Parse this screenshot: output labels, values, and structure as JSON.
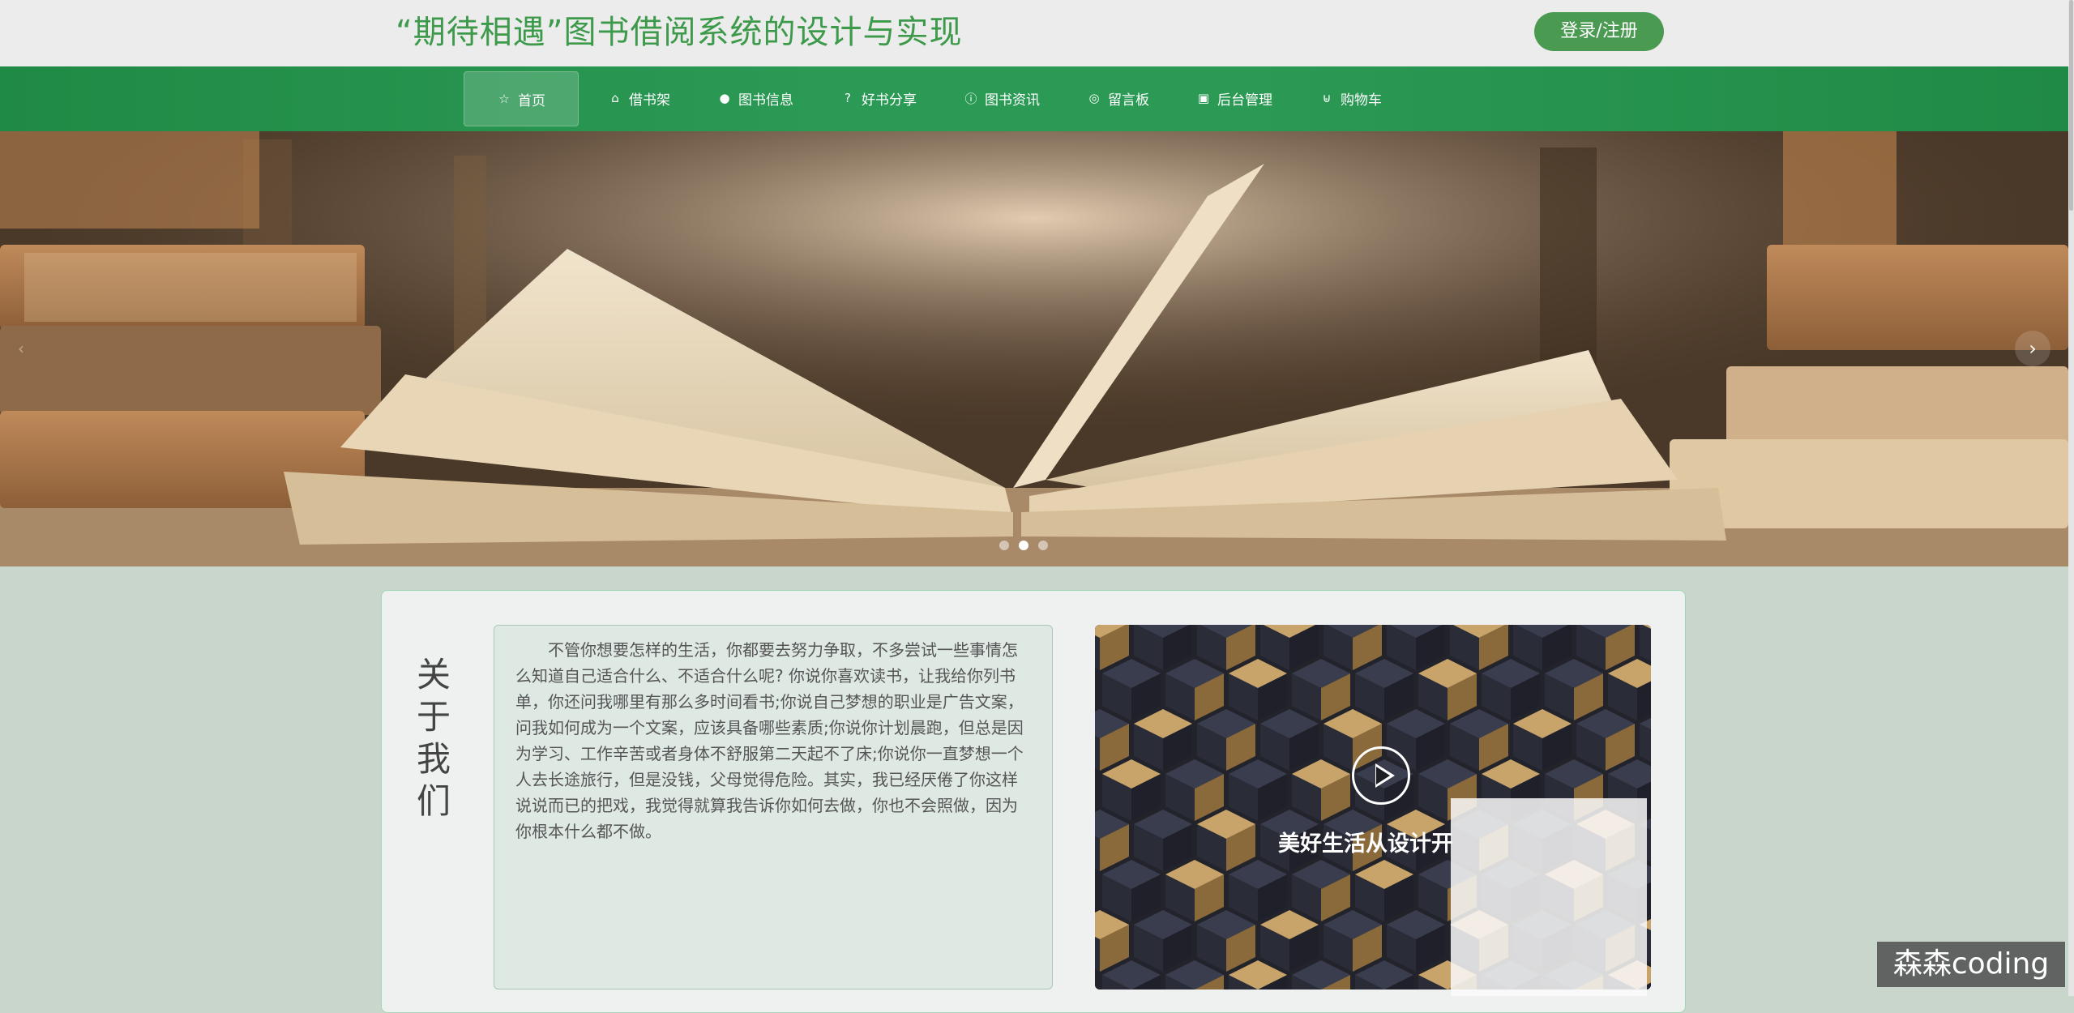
{
  "header": {
    "site_title": "“期待相遇”图书借阅系统的设计与实现",
    "login_label": "登录/注册"
  },
  "nav": {
    "items": [
      {
        "label": "首页",
        "icon": "star-icon",
        "glyph": "☆"
      },
      {
        "label": "借书架",
        "icon": "shelf-icon",
        "glyph": "⌂"
      },
      {
        "label": "图书信息",
        "icon": "info-icon",
        "glyph": "●"
      },
      {
        "label": "好书分享",
        "icon": "question-icon",
        "glyph": "?"
      },
      {
        "label": "图书资讯",
        "icon": "info-icon",
        "glyph": "ⓘ"
      },
      {
        "label": "留言板",
        "icon": "globe-icon",
        "glyph": "◎"
      },
      {
        "label": "后台管理",
        "icon": "clipboard-icon",
        "glyph": "▣"
      },
      {
        "label": "购物车",
        "icon": "cart-icon",
        "glyph": "⊌"
      }
    ]
  },
  "banner": {
    "arrow_right": "›",
    "arrow_left": "‹",
    "active_slide": 2,
    "slide_count": 3
  },
  "about": {
    "title": "关于我们",
    "text": "不管你想要怎样的生活，你都要去努力争取，不多尝试一些事情怎么知道自己适合什么、不适合什么呢? 你说你喜欢读书，让我给你列书单，你还问我哪里有那么多时间看书;你说自己梦想的职业是广告文案，问我如何成为一个文案，应该具备哪些素质;你说你计划晨跑，但总是因为学习、工作辛苦或者身体不舒服第二天起不了床;你说你一直梦想一个人去长途旅行，但是没钱，父母觉得危险。其实，我已经厌倦了你这样说说而已的把戏，我觉得就算我告诉你如何去做，你也不会照做，因为你根本什么都不做。",
    "video_caption": "美好生活从设计开"
  },
  "watermark": "森森coding"
}
